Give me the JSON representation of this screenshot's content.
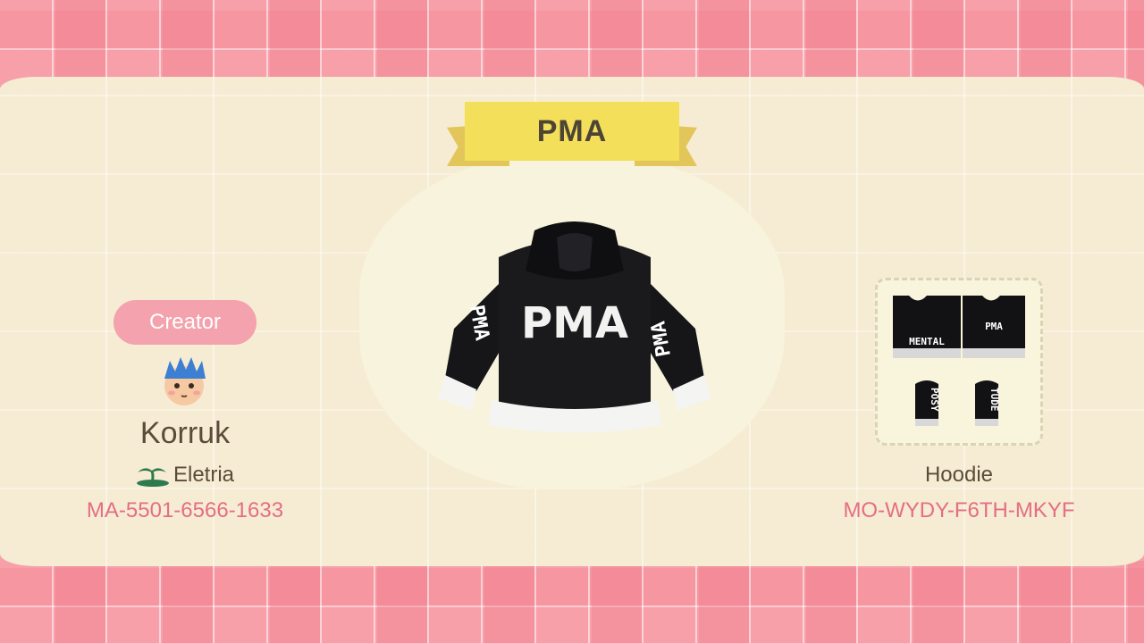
{
  "design": {
    "title": "PMA",
    "item_type": "Hoodie",
    "design_code": "MO-WYDY-F6TH-MKYF",
    "hoodie_print": "PMA",
    "pattern_labels": {
      "front": "MENTAL",
      "back": "PMA",
      "left_sleeve": "POSY",
      "right_sleeve": "TUDE"
    }
  },
  "creator": {
    "badge": "Creator",
    "name": "Korruk",
    "island": "Eletria",
    "creator_id": "MA-5501-6566-1633"
  },
  "icons": {
    "island": "palm-tree-icon",
    "avatar": "villager-avatar-icon"
  },
  "colors": {
    "accent_pink": "#f4a2ad",
    "code_text": "#e46e84",
    "ribbon": "#f3df5a",
    "cream": "#f6ecd3"
  }
}
